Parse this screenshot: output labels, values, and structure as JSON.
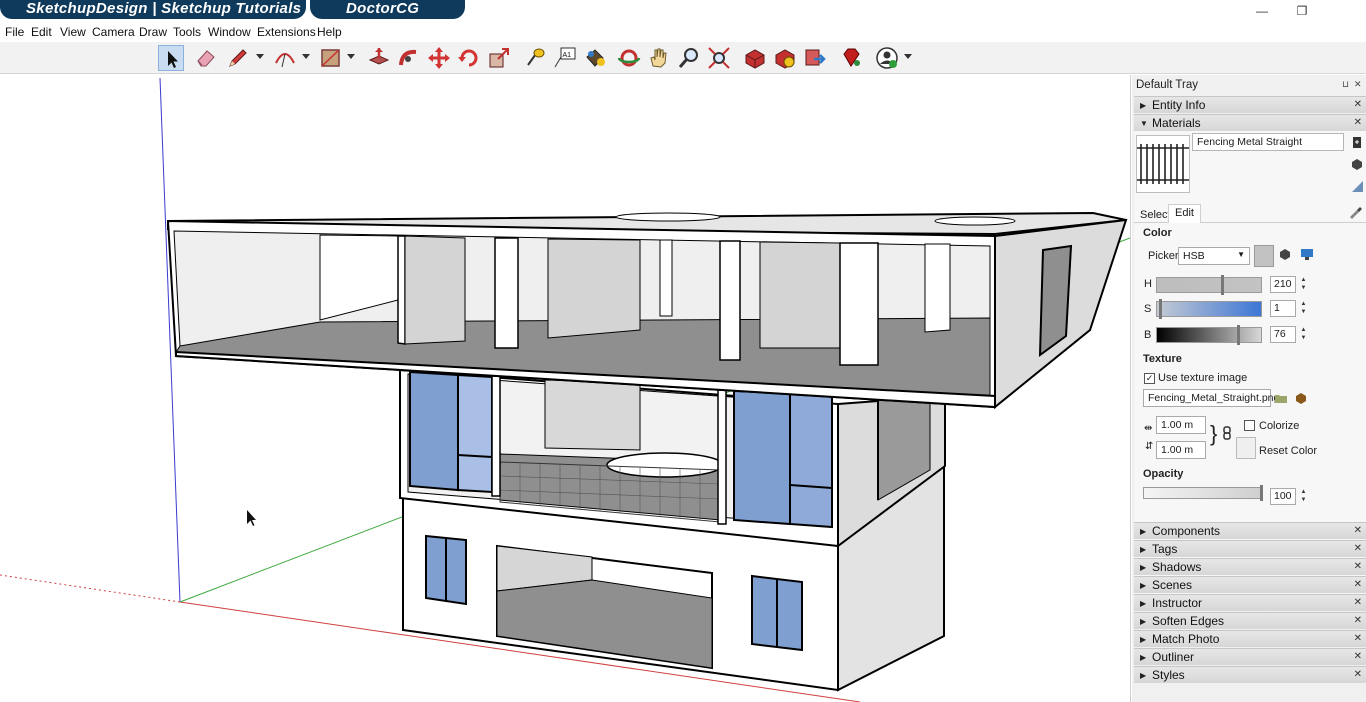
{
  "title_bar": {
    "tab1": "SketchupDesign | Sketchup Tutorials",
    "tab2": "DoctorCG",
    "minimize": "—",
    "maximize": "❐"
  },
  "menu": [
    "File",
    "Edit",
    "View",
    "Camera",
    "Draw",
    "Tools",
    "Window",
    "Extensions",
    "Help"
  ],
  "toolbar": {
    "tools": [
      "select-tool",
      "eraser-tool",
      "pencil-tool",
      "arc-tool",
      "shape-tool",
      "push-pull-tool",
      "follow-me-tool",
      "move-tool",
      "rotate-tool",
      "scale-tool",
      "tape-measure-tool",
      "text-tool",
      "paint-bucket-tool",
      "orbit-tool",
      "pan-tool",
      "zoom-tool",
      "zoom-extents-tool",
      "3d-warehouse-tool",
      "extension-warehouse-tool",
      "layout-tool",
      "ruby-tool",
      "user-account-tool"
    ],
    "text_tool_glyph": "A1"
  },
  "tray": {
    "title": "Default Tray",
    "pin": "⊔",
    "close": "✕",
    "entity_info": "Entity Info",
    "materials": {
      "header": "Materials",
      "name": "Fencing Metal Straight",
      "tab_select": "Select",
      "tab_edit": "Edit",
      "color_label": "Color",
      "picker_label": "Picker:",
      "picker_value": "HSB",
      "h_label": "H",
      "h_value": "210",
      "s_label": "S",
      "s_value": "1",
      "b_label": "B",
      "b_value": "76",
      "texture_label": "Texture",
      "use_texture_label": "Use texture image",
      "use_texture_checked": "✓",
      "texture_file": "Fencing_Metal_Straight.png",
      "width_value": "1.00 m",
      "height_value": "1.00 m",
      "colorize_label": "Colorize",
      "reset_color_label": "Reset Color",
      "opacity_label": "Opacity",
      "opacity_value": "100"
    },
    "panels": [
      "Components",
      "Tags",
      "Shadows",
      "Scenes",
      "Instructor",
      "Soften Edges",
      "Match Photo",
      "Outliner",
      "Styles"
    ]
  },
  "colors": {
    "tab_bg": "#0f3a5c",
    "glass": "#7f9fd0",
    "gray_floor": "#8f8f8f",
    "axis_red": "#d04040",
    "axis_green": "#3aa83a",
    "axis_blue": "#3a3ad0"
  }
}
